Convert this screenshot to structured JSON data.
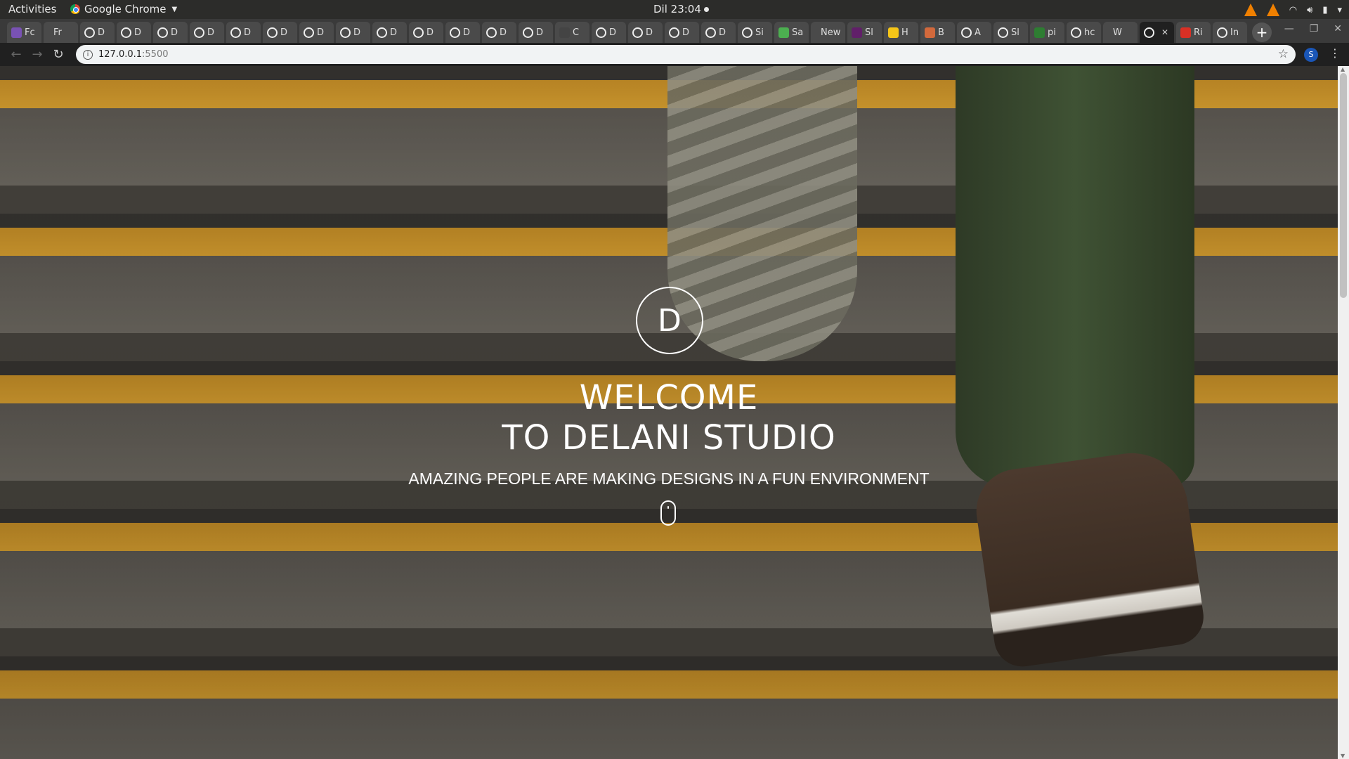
{
  "os_bar": {
    "activities": "Activities",
    "app_name": "Google Chrome",
    "clock": "Dil 23:04"
  },
  "tabs": [
    {
      "label": "Fc",
      "icon": "bootstrap-icon"
    },
    {
      "label": "Fr",
      "icon": "blank-icon"
    },
    {
      "label": "D",
      "icon": "globe-icon"
    },
    {
      "label": "D",
      "icon": "github-icon"
    },
    {
      "label": "D",
      "icon": "github-icon"
    },
    {
      "label": "D",
      "icon": "github-icon"
    },
    {
      "label": "D",
      "icon": "github-icon"
    },
    {
      "label": "D",
      "icon": "globe-icon"
    },
    {
      "label": "D",
      "icon": "github-icon"
    },
    {
      "label": "D",
      "icon": "github-icon"
    },
    {
      "label": "D",
      "icon": "github-icon"
    },
    {
      "label": "D",
      "icon": "globe-icon"
    },
    {
      "label": "D",
      "icon": "github-icon"
    },
    {
      "label": "D",
      "icon": "github-icon"
    },
    {
      "label": "D",
      "icon": "github-icon"
    },
    {
      "label": "C",
      "icon": "dt-icon"
    },
    {
      "label": "D",
      "icon": "globe-icon"
    },
    {
      "label": "D",
      "icon": "github-icon"
    },
    {
      "label": "D",
      "icon": "github-icon"
    },
    {
      "label": "D",
      "icon": "github-icon"
    },
    {
      "label": "Si",
      "icon": "spinner-icon"
    },
    {
      "label": "Sa",
      "icon": "download-icon"
    },
    {
      "label": "New",
      "icon": "blank-icon"
    },
    {
      "label": "Sl",
      "icon": "slack-icon"
    },
    {
      "label": "H",
      "icon": "yellow-badge-icon"
    },
    {
      "label": "B",
      "icon": "orange-badge-icon"
    },
    {
      "label": "A",
      "icon": "github-icon"
    },
    {
      "label": "Sl",
      "icon": "github-icon"
    },
    {
      "label": "pi",
      "icon": "green-badge-icon"
    },
    {
      "label": "hc",
      "icon": "google-icon"
    },
    {
      "label": "W",
      "icon": "blank-icon"
    },
    {
      "label": "",
      "icon": "globe-icon",
      "active": true
    },
    {
      "label": "Ri",
      "icon": "gmail-icon"
    },
    {
      "label": "In",
      "icon": "globe-icon"
    }
  ],
  "address_bar": {
    "host": "127.0.0.1",
    "port": ":5500",
    "profile_initial": "S"
  },
  "hero": {
    "logo_letter": "D",
    "title_line1": "WELCOME",
    "title_line2": "TO DELANI STUDIO",
    "subtitle": "AMAZING PEOPLE ARE MAKING DESIGNS IN A FUN ENVIRONMENT"
  },
  "colors": {
    "stair_yellow": "#c8922a",
    "text": "#ffffff",
    "profile_blue": "#1a56b7",
    "vlc_orange": "#f08000"
  }
}
